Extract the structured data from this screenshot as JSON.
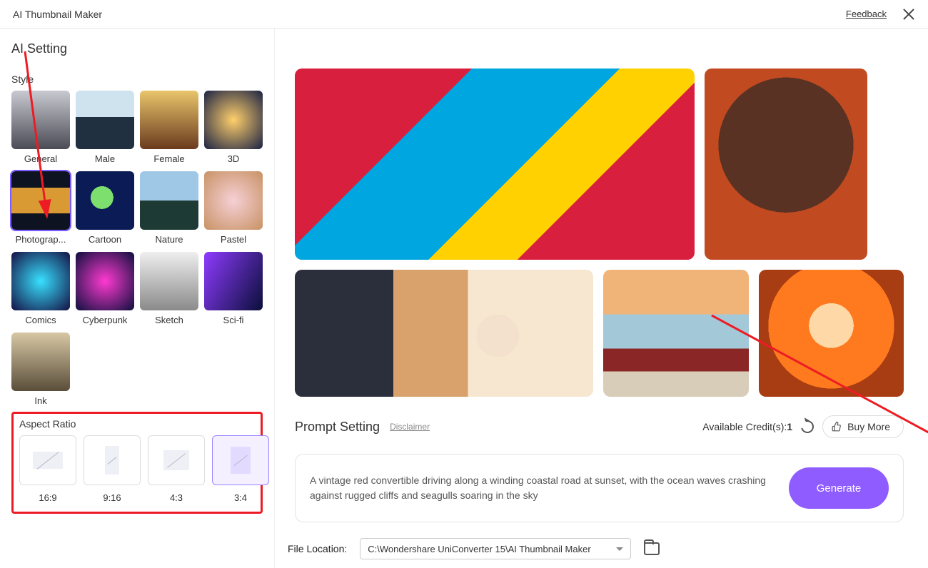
{
  "titlebar": {
    "title": "AI Thumbnail Maker",
    "feedback": "Feedback"
  },
  "sidebar": {
    "heading": "AI Setting",
    "style_label": "Style",
    "styles": [
      {
        "name": "General"
      },
      {
        "name": "Male"
      },
      {
        "name": "Female"
      },
      {
        "name": "3D"
      },
      {
        "name": "Photograp..."
      },
      {
        "name": "Cartoon"
      },
      {
        "name": "Nature"
      },
      {
        "name": "Pastel"
      },
      {
        "name": "Comics"
      },
      {
        "name": "Cyberpunk"
      },
      {
        "name": "Sketch"
      },
      {
        "name": "Sci-fi"
      },
      {
        "name": "Ink"
      }
    ],
    "selected_style_index": 4,
    "aspect_label": "Aspect Ratio",
    "aspects": [
      {
        "label": "16:9"
      },
      {
        "label": "9:16"
      },
      {
        "label": "4:3"
      },
      {
        "label": "3:4"
      }
    ],
    "selected_aspect_index": 3
  },
  "main": {
    "prompt_title": "Prompt Setting",
    "disclaimer": "Disclaimer",
    "credit_prefix": "Available Credit(s):",
    "credit_value": "1",
    "buy_more": "Buy More",
    "prompt_text": "A vintage red convertible driving along a winding coastal road at sunset, with the ocean waves crashing against rugged cliffs and seagulls soaring in the sky",
    "generate": "Generate",
    "file_loc_label": "File Location:",
    "file_loc_value": "C:\\Wondershare UniConverter 15\\AI Thumbnail Maker"
  }
}
